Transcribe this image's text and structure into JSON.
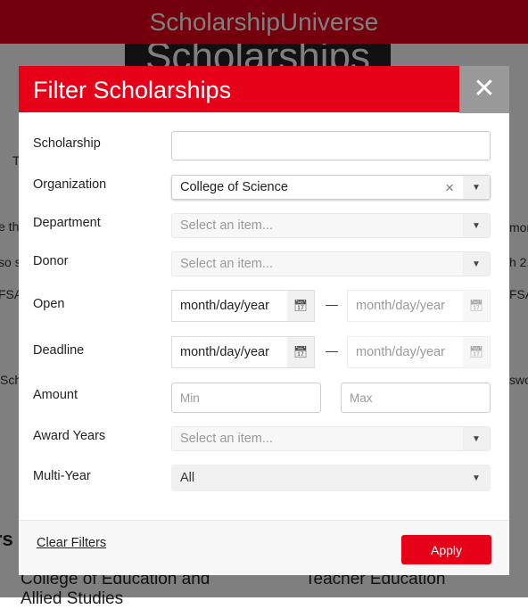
{
  "app": {
    "title": "ScholarshipUniverse",
    "hero": "Scholarships"
  },
  "background": {
    "left_fragments": [
      "T",
      "e th",
      "so s",
      "FSA",
      "Sch"
    ],
    "right_fragments": [
      "mor",
      "h 2,",
      "FSA",
      "swo"
    ],
    "heading_fragment": "rs",
    "col1": "College of Education and Allied Studies",
    "col2": "Teacher Education"
  },
  "modal": {
    "title": "Filter Scholarships",
    "close": "✕",
    "fields": {
      "scholarship": {
        "label": "Scholarship",
        "value": ""
      },
      "organization": {
        "label": "Organization",
        "value": "College of Science"
      },
      "department": {
        "label": "Department",
        "placeholder": "Select an item..."
      },
      "donor": {
        "label": "Donor",
        "placeholder": "Select an item..."
      },
      "open": {
        "label": "Open",
        "from": "month/day/year",
        "to": "month/day/year"
      },
      "deadline": {
        "label": "Deadline",
        "from": "month/day/year",
        "to": "month/day/year"
      },
      "amount": {
        "label": "Amount",
        "min_placeholder": "Min",
        "max_placeholder": "Max"
      },
      "award_years": {
        "label": "Award Years",
        "placeholder": "Select an item..."
      },
      "multi_year": {
        "label": "Multi-Year",
        "value": "All"
      }
    },
    "dash": "—",
    "clear_filters": "Clear Filters",
    "apply": "Apply"
  },
  "colors": {
    "brand": "#e60018"
  }
}
